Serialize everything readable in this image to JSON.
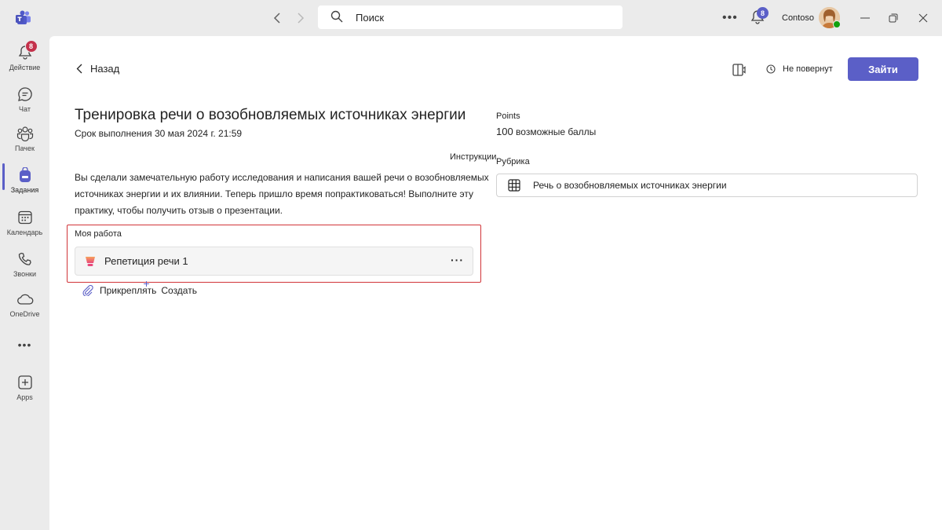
{
  "topbar": {
    "search_placeholder": "Поиск",
    "notifications_count": "8",
    "org_name": "Contoso"
  },
  "rail": {
    "items": [
      {
        "label": "Действие",
        "badge": "8"
      },
      {
        "label": "Чат"
      },
      {
        "label": "Пачек"
      },
      {
        "label": "Задания"
      },
      {
        "label": "Календарь"
      },
      {
        "label": "Звонки"
      },
      {
        "label": "OneDrive"
      },
      {
        "label": "..."
      },
      {
        "label": "Apps"
      }
    ],
    "active_index": 3
  },
  "header": {
    "back_label": "Назад",
    "status_label": "Не повернут",
    "join_label": "Зайти"
  },
  "assignment": {
    "title": "Тренировка речи о возобновляемых источниках энергии",
    "due": "Срок выполнения 30 мая 2024 г. 21:59",
    "instructions_label": "Инструкции",
    "description": "Вы сделали замечательную работу исследования и написания вашей речи о возобновляемых источниках энергии и их влиянии. Теперь пришло время попрактиковаться! Выполните эту практику, чтобы получить отзыв о презентации.",
    "my_work_label": "Моя работа",
    "work_item_name": "Репетиция речи 1",
    "attach_label": "Прикреплять",
    "create_label": "Создать",
    "points_label": "Points",
    "points_value": "100",
    "points_suffix": "возможные баллы",
    "rubric_label": "Рубрика",
    "rubric_name": "Речь о возобновляемых источниках энергии"
  },
  "colors": {
    "accent": "#5b5fc7",
    "highlight_border": "#d13438",
    "badge_red": "#c4314b",
    "presence_green": "#13a10e"
  }
}
